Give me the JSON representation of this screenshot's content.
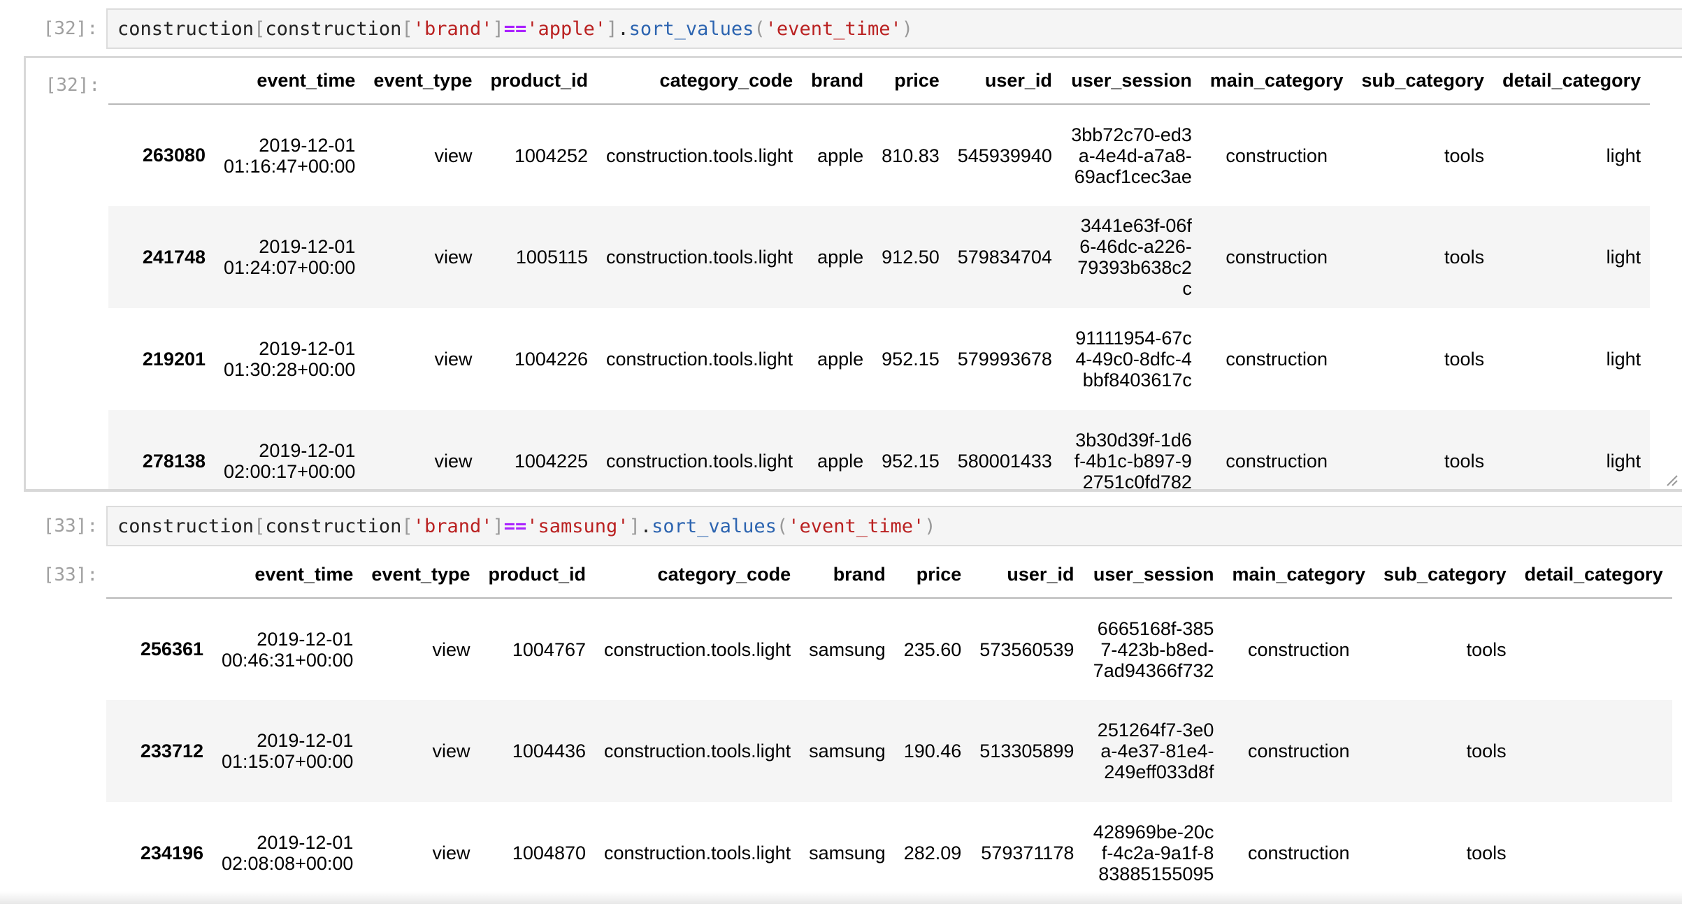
{
  "cells": [
    {
      "in_prompt": "[32]:",
      "out_prompt": "[32]:",
      "code": {
        "t1": "construction",
        "t2": "[",
        "t3": "construction",
        "t4": "[",
        "t5": "'brand'",
        "t6": "]",
        "t7": "==",
        "t8": "'apple'",
        "t9": "]",
        "t10": ".",
        "t11": "sort_values",
        "t12": "(",
        "t13": "'event_time'",
        "t14": ")"
      },
      "columns": [
        "",
        "event_time",
        "event_type",
        "product_id",
        "category_code",
        "brand",
        "price",
        "user_id",
        "user_session",
        "main_category",
        "sub_category",
        "detail_category"
      ],
      "rows": [
        {
          "index": "263080",
          "event_time": "2019-12-01 01:16:47+00:00",
          "event_type": "view",
          "product_id": "1004252",
          "category_code": "construction.tools.light",
          "brand": "apple",
          "price": "810.83",
          "user_id": "545939940",
          "user_session": "3bb72c70-ed3a-4e4d-a7a8-69acf1cec3ae",
          "main_category": "construction",
          "sub_category": "tools",
          "detail_category": "light"
        },
        {
          "index": "241748",
          "event_time": "2019-12-01 01:24:07+00:00",
          "event_type": "view",
          "product_id": "1005115",
          "category_code": "construction.tools.light",
          "brand": "apple",
          "price": "912.50",
          "user_id": "579834704",
          "user_session": "3441e63f-06f6-46dc-a226-79393b638c2c",
          "main_category": "construction",
          "sub_category": "tools",
          "detail_category": "light"
        },
        {
          "index": "219201",
          "event_time": "2019-12-01 01:30:28+00:00",
          "event_type": "view",
          "product_id": "1004226",
          "category_code": "construction.tools.light",
          "brand": "apple",
          "price": "952.15",
          "user_id": "579993678",
          "user_session": "91111954-67c4-49c0-8dfc-4bbf8403617c",
          "main_category": "construction",
          "sub_category": "tools",
          "detail_category": "light"
        },
        {
          "index": "278138",
          "event_time": "2019-12-01 02:00:17+00:00",
          "event_type": "view",
          "product_id": "1004225",
          "category_code": "construction.tools.light",
          "brand": "apple",
          "price": "952.15",
          "user_id": "580001433",
          "user_session": "3b30d39f-1d6f-4b1c-b897-92751c0fd782",
          "main_category": "construction",
          "sub_category": "tools",
          "detail_category": "light"
        }
      ]
    },
    {
      "in_prompt": "[33]:",
      "out_prompt": "[33]:",
      "code": {
        "t1": "construction",
        "t2": "[",
        "t3": "construction",
        "t4": "[",
        "t5": "'brand'",
        "t6": "]",
        "t7": "==",
        "t8": "'samsung'",
        "t9": "]",
        "t10": ".",
        "t11": "sort_values",
        "t12": "(",
        "t13": "'event_time'",
        "t14": ")"
      },
      "columns": [
        "",
        "event_time",
        "event_type",
        "product_id",
        "category_code",
        "brand",
        "price",
        "user_id",
        "user_session",
        "main_category",
        "sub_category",
        "detail_category"
      ],
      "rows": [
        {
          "index": "256361",
          "event_time": "2019-12-01 00:46:31+00:00",
          "event_type": "view",
          "product_id": "1004767",
          "category_code": "construction.tools.light",
          "brand": "samsung",
          "price": "235.60",
          "user_id": "573560539",
          "user_session": "6665168f-3857-423b-b8ed-7ad94366f732",
          "main_category": "construction",
          "sub_category": "tools",
          "detail_category": ""
        },
        {
          "index": "233712",
          "event_time": "2019-12-01 01:15:07+00:00",
          "event_type": "view",
          "product_id": "1004436",
          "category_code": "construction.tools.light",
          "brand": "samsung",
          "price": "190.46",
          "user_id": "513305899",
          "user_session": "251264f7-3e0a-4e37-81e4-249eff033d8f",
          "main_category": "construction",
          "sub_category": "tools",
          "detail_category": ""
        },
        {
          "index": "234196",
          "event_time": "2019-12-01 02:08:08+00:00",
          "event_type": "view",
          "product_id": "1004870",
          "category_code": "construction.tools.light",
          "brand": "samsung",
          "price": "282.09",
          "user_id": "579371178",
          "user_session": "428969be-20cf-4c2a-9a1f-883885155095",
          "main_category": "construction",
          "sub_category": "tools",
          "detail_category": ""
        }
      ]
    }
  ]
}
